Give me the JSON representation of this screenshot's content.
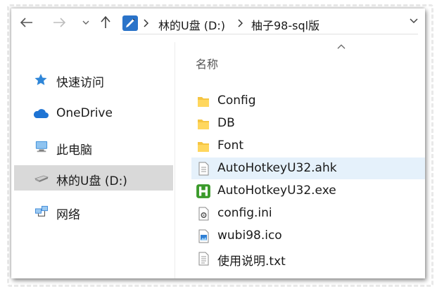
{
  "address": {
    "crumbs": [
      "林的U盘 (D:)",
      "柚子98-sql版"
    ]
  },
  "sidebar": {
    "items": [
      {
        "label": "快速访问",
        "icon": "star-icon"
      },
      {
        "label": "OneDrive",
        "icon": "cloud-icon"
      },
      {
        "label": "此电脑",
        "icon": "computer-icon"
      },
      {
        "label": "林的U盘 (D:)",
        "icon": "usb-drive-icon",
        "selected": true
      },
      {
        "label": "网络",
        "icon": "network-icon"
      }
    ]
  },
  "main": {
    "column_header": "名称",
    "files": [
      {
        "name": "Config",
        "icon": "folder-icon"
      },
      {
        "name": "DB",
        "icon": "folder-icon"
      },
      {
        "name": "Font",
        "icon": "folder-icon"
      },
      {
        "name": "AutoHotkeyU32.ahk",
        "icon": "text-file-icon",
        "hover": true
      },
      {
        "name": "AutoHotkeyU32.exe",
        "icon": "autohotkey-icon"
      },
      {
        "name": "config.ini",
        "icon": "settings-file-icon"
      },
      {
        "name": "wubi98.ico",
        "icon": "image-file-icon"
      },
      {
        "name": "使用说明.txt",
        "icon": "text-file-icon"
      }
    ]
  },
  "colors": {
    "selected_bg": "#d9d9d9",
    "hover_bg": "#e5f1fb",
    "folder": "#f5c542"
  }
}
